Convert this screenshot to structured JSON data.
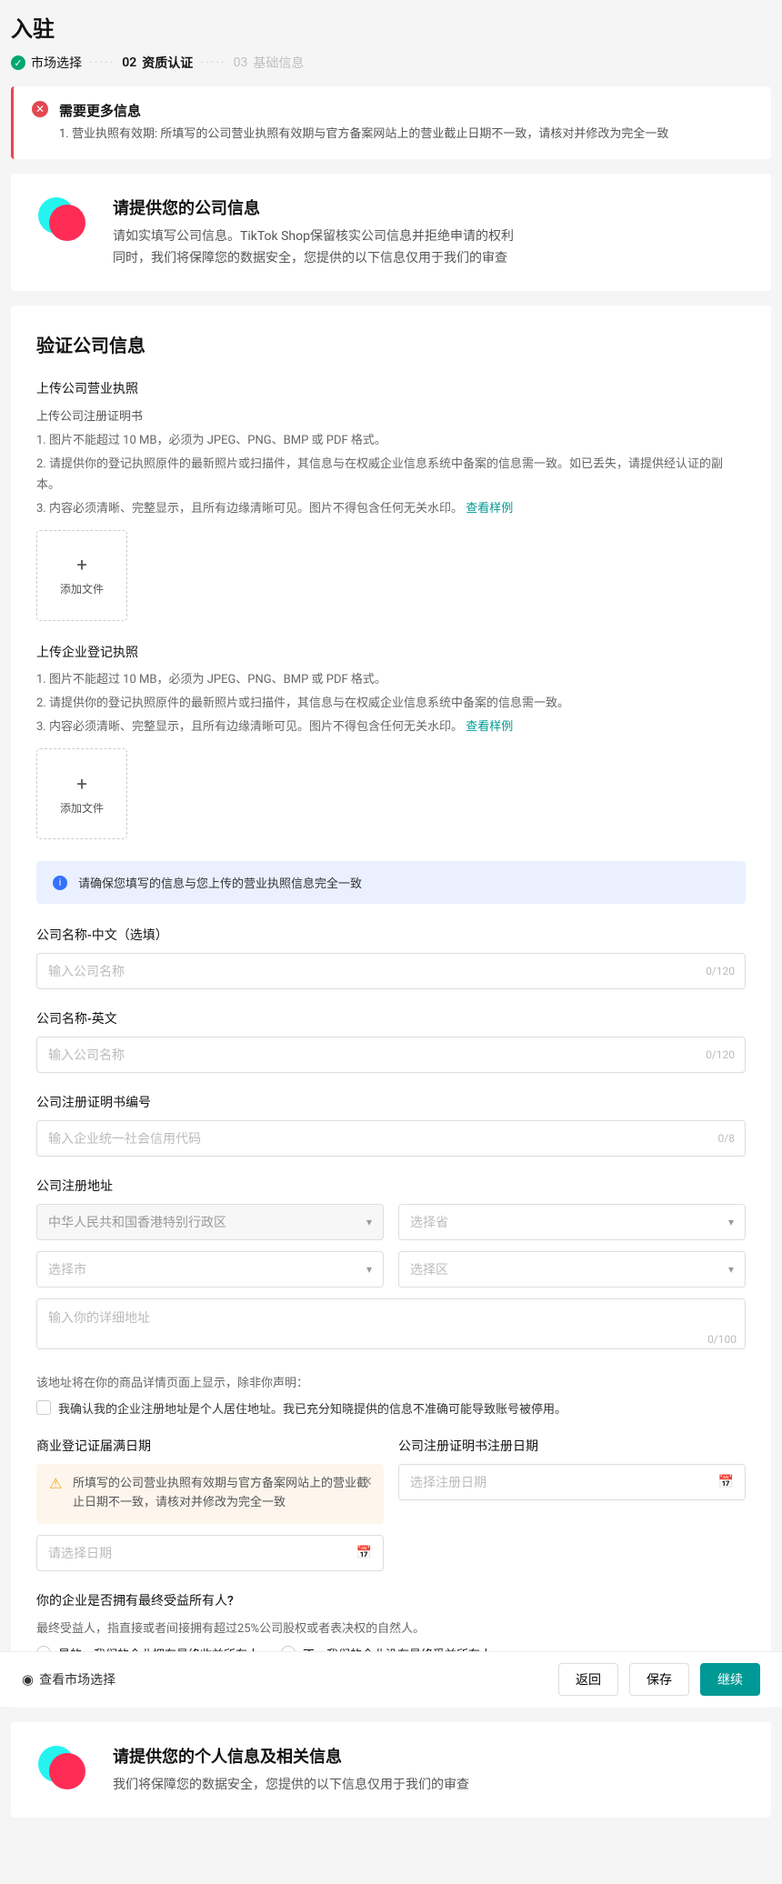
{
  "page_title": "入驻",
  "steps": {
    "s1": "市场选择",
    "s2_num": "02",
    "s2": "资质认证",
    "s3_num": "03",
    "s3": "基础信息"
  },
  "alert": {
    "title": "需要更多信息",
    "item1": "1. 营业执照有效期: 所填写的公司营业执照有效期与官方备案网站上的营业截止日期不一致，请核对并修改为完全一致"
  },
  "intro": {
    "title": "请提供您的公司信息",
    "line1": "请如实填写公司信息。TikTok Shop保留核实公司信息并拒绝申请的权利",
    "line2": "同时，我们将保障您的数据安全，您提供的以下信息仅用于我们的审查"
  },
  "verify": {
    "title": "验证公司信息",
    "upload1_label": "上传公司营业执照",
    "upload1_sub": "上传公司注册证明书",
    "hint1": "1. 图片不能超过 10 MB，必须为 JPEG、PNG、BMP 或 PDF 格式。",
    "hint2": "2. 请提供你的登记执照原件的最新照片或扫描件，其信息与在权威企业信息系统中备案的信息需一致。如已丢失，请提供经认证的副本。",
    "hint3_prefix": "3. 内容必须清晰、完整显示，且所有边缘清晰可见。图片不得包含任何无关水印。",
    "view_example": "查看样例",
    "add_file": "添加文件",
    "upload2_label": "上传企业登记执照",
    "hint2_2": "2. 请提供你的登记执照原件的最新照片或扫描件，其信息与在权威企业信息系统中备案的信息需一致。",
    "banner": "请确保您填写的信息与您上传的营业执照信息完全一致",
    "name_cn_label": "公司名称-中文（选填）",
    "name_cn_ph": "输入公司名称",
    "name_cn_counter": "0/120",
    "name_en_label": "公司名称-英文",
    "name_en_ph": "输入公司名称",
    "name_en_counter": "0/120",
    "reg_no_label": "公司注册证明书编号",
    "reg_no_ph": "输入企业统一社会信用代码",
    "reg_no_counter": "0/8",
    "addr_label": "公司注册地址",
    "addr_country": "中华人民共和国香港特别行政区",
    "addr_province_ph": "选择省",
    "addr_city_ph": "选择市",
    "addr_district_ph": "选择区",
    "addr_detail_ph": "输入你的详细地址",
    "addr_detail_counter": "0/100",
    "addr_display_hint": "该地址将在你的商品详情页面上显示，除非你声明：",
    "addr_checkbox": "我确认我的企业注册地址是个人居住地址。我已充分知晓提供的信息不准确可能导致账号被停用。",
    "expiry_label": "商业登记证届满日期",
    "expiry_warn": "所填写的公司营业执照有效期与官方备案网站上的营业截止日期不一致，请核对并修改为完全一致",
    "expiry_date_ph": "请选择日期",
    "reg_date_label": "公司注册证明书注册日期",
    "reg_date_ph": "选择注册日期",
    "ubo_label": "你的企业是否拥有最终受益所有人?",
    "ubo_hint": "最终受益人，指直接或者间接拥有超过25%公司股权或者表决权的自然人。",
    "ubo_yes": "是的，我们的企业拥有最终收益所有人",
    "ubo_no": "不，我们的企业没有最终受益所有人"
  },
  "personal": {
    "title": "请提供您的个人信息及相关信息",
    "sub": "我们将保障您的数据安全，您提供的以下信息仅用于我们的审查"
  },
  "footer": {
    "view_market": "查看市场选择",
    "back": "返回",
    "save": "保存",
    "continue": "继续"
  }
}
